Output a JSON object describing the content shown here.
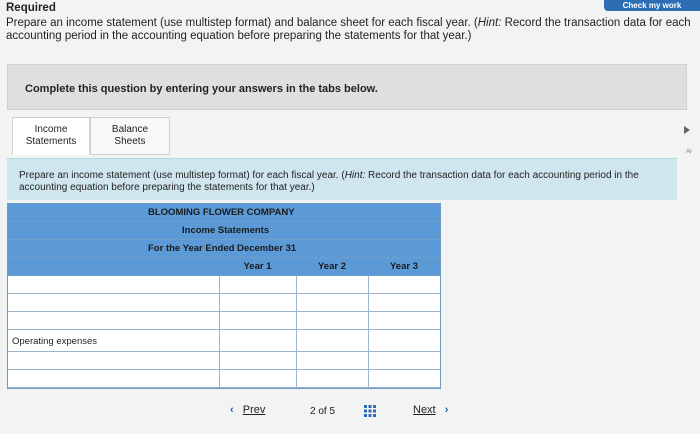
{
  "header": {
    "check_label": "Check my work",
    "required_title": "Required",
    "required_text": "Prepare an income statement (use multistep format) and balance sheet for each fiscal year. (",
    "hint_label": "Hint:",
    "hint_text": " Record the transaction data for each accounting period in the accounting equation before preparing the statements for that year.)"
  },
  "complete_bar": "Complete this question by entering your answers in the tabs below.",
  "tabs": [
    {
      "label_line1": "Income",
      "label_line2": "Statements"
    },
    {
      "label_line1": "Balance",
      "label_line2": "Sheets"
    }
  ],
  "side_tag": "Ar",
  "instruction": {
    "text": "Prepare an income statement (use multistep format) for each fiscal year. (",
    "hint_label": "Hint:",
    "hint_text": " Record the transaction data for each accounting period in the accounting equation before preparing the statements for that year.)"
  },
  "statement": {
    "company": "BLOOMING FLOWER COMPANY",
    "title": "Income Statements",
    "period": "For the Year Ended December 31",
    "columns": [
      "Year 1",
      "Year 2",
      "Year 3"
    ],
    "rows": [
      {
        "label": "",
        "values": [
          "",
          "",
          ""
        ]
      },
      {
        "label": "",
        "values": [
          "",
          "",
          ""
        ]
      },
      {
        "label": "",
        "values": [
          "",
          "",
          ""
        ]
      },
      {
        "label": "Operating expenses",
        "values": [
          "",
          "",
          ""
        ]
      },
      {
        "label": "",
        "values": [
          "",
          "",
          ""
        ]
      },
      {
        "label": "",
        "values": [
          "",
          "",
          ""
        ]
      }
    ]
  },
  "navigation": {
    "prev_label": "Prev",
    "page_current": "2",
    "page_of": "of",
    "page_total": "5",
    "next_label": "Next"
  }
}
